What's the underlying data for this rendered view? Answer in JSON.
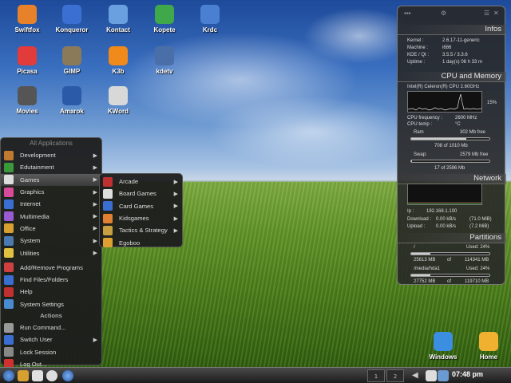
{
  "desktop": {
    "icons": [
      {
        "label": "Swiftfox",
        "icon": "swiftfox-icon",
        "color": "#e8822a"
      },
      {
        "label": "Konqueror",
        "icon": "konqueror-icon",
        "color": "#3b6fd1"
      },
      {
        "label": "Kontact",
        "icon": "kontact-icon",
        "color": "#6aa0e0"
      },
      {
        "label": "Kopete",
        "icon": "kopete-icon",
        "color": "#3fa84a"
      },
      {
        "label": "Krdc",
        "icon": "krdc-icon",
        "color": "#4a7fd1"
      },
      {
        "label": "Picasa",
        "icon": "picasa-icon",
        "color": "#e23b3b"
      },
      {
        "label": "GIMP",
        "icon": "gimp-icon",
        "color": "#8a7a5a"
      },
      {
        "label": "K3b",
        "icon": "k3b-icon",
        "color": "#f08a1a"
      },
      {
        "label": "kdetv",
        "icon": "kdetv-icon",
        "color": "#4a6fa8"
      },
      {
        "label": "Movies",
        "icon": "movies-icon",
        "color": "#555555"
      },
      {
        "label": "Amarok",
        "icon": "amarok-icon",
        "color": "#2b5aa8"
      },
      {
        "label": "KWord",
        "icon": "kword-icon",
        "color": "#d8d8d8"
      },
      {
        "label": "Windows",
        "icon": "folder-icon",
        "color": "#3b8ee0"
      },
      {
        "label": "Home",
        "icon": "home-icon",
        "color": "#f0b030"
      }
    ]
  },
  "start_menu": {
    "header": "All Applications",
    "items": [
      {
        "label": "Development",
        "color": "#c07a30",
        "arrow": "▶"
      },
      {
        "label": "Edutainment",
        "color": "#3a9a3a",
        "arrow": "▶"
      },
      {
        "label": "Games",
        "color": "#dddddd",
        "arrow": "▶"
      },
      {
        "label": "Graphics",
        "color": "#d84a9a",
        "arrow": "▶"
      },
      {
        "label": "Internet",
        "color": "#3a6fd1",
        "arrow": "▶"
      },
      {
        "label": "Multimedia",
        "color": "#9a5ad1",
        "arrow": "▶"
      },
      {
        "label": "Office",
        "color": "#d8a030",
        "arrow": "▶"
      },
      {
        "label": "System",
        "color": "#4a7ab0",
        "arrow": "▶"
      },
      {
        "label": "Utilities",
        "color": "#e0c040",
        "arrow": "▶"
      }
    ],
    "quick": [
      {
        "label": "Add/Remove Programs",
        "color": "#d04040"
      },
      {
        "label": "Find Files/Folders",
        "color": "#3a6fd1"
      },
      {
        "label": "Help",
        "color": "#c03030"
      },
      {
        "label": "System Settings",
        "color": "#4a8ad1"
      }
    ],
    "actions_header": "Actions",
    "actions": [
      {
        "label": "Run Command...",
        "color": "#999999"
      },
      {
        "label": "Switch User",
        "color": "#3a6fd1",
        "arrow": "▶"
      },
      {
        "label": "Lock Session",
        "color": "#888888"
      },
      {
        "label": "Log Out...",
        "color": "#d03030"
      }
    ]
  },
  "games_menu": {
    "items": [
      {
        "label": "Arcade",
        "color": "#c03030",
        "arrow": "▶"
      },
      {
        "label": "Board Games",
        "color": "#dddddd",
        "arrow": "▶"
      },
      {
        "label": "Card Games",
        "color": "#3a6fd1",
        "arrow": "▶"
      },
      {
        "label": "Kidsgames",
        "color": "#e08030",
        "arrow": "▶"
      },
      {
        "label": "Tactics & Strategy",
        "color": "#c8a040",
        "arrow": "▶"
      },
      {
        "label": "Egoboo",
        "color": "#e0a030"
      }
    ]
  },
  "sysmon": {
    "infos_title": "Infos",
    "infos": [
      {
        "k": "Kernel :",
        "v": "2.6.17-11-generic"
      },
      {
        "k": "Machine :",
        "v": "i686"
      },
      {
        "k": "KDE / Qt :",
        "v": "3.5.5     /      3.3.6"
      },
      {
        "k": "Uptime :",
        "v": "1 day(s)  06 h 33 m"
      }
    ],
    "cpu_title": "CPU and Memory",
    "cpu_name": "Intel(R) Celeron(R) CPU 2.60GHz",
    "cpu_percent": "15%",
    "cpu_freq_label": "CPU frequency :",
    "cpu_freq_value": "2600 MHz",
    "cpu_temp_label": "CPU temp :",
    "cpu_temp_value": "°C",
    "ram_label": "Ram",
    "ram_free": "302 Mb free",
    "ram_used": "708 of 1010 Mb",
    "ram_fraction": 0.7,
    "swap_label": "Swap:",
    "swap_free": "2579 Mb free",
    "swap_used": "17 of 2596 Mb",
    "swap_fraction": 0.01,
    "net_title": "Network",
    "ip_label": "Ip :",
    "ip_value": "192.168.1.100",
    "download_label": "Download :",
    "download_value": "0.00 kB/s",
    "download_total": "(71.0 MiB)",
    "upload_label": "Upload :",
    "upload_value": "0.00 kB/s",
    "upload_total": "(7.2 MiB)",
    "part_title": "Partitions",
    "partitions": [
      {
        "mount": "/",
        "used": "Used: 24%",
        "size_a": "25613 MB",
        "of": "of",
        "size_b": "114341 MB",
        "fraction": 0.24
      },
      {
        "mount": "/media/hda1",
        "used": "Used: 24%",
        "size_a": "27752 MB",
        "of": "of",
        "size_b": "119710 MB",
        "fraction": 0.24
      }
    ]
  },
  "taskbar": {
    "pager": [
      "1",
      "2"
    ],
    "clock": "07:48 pm"
  }
}
